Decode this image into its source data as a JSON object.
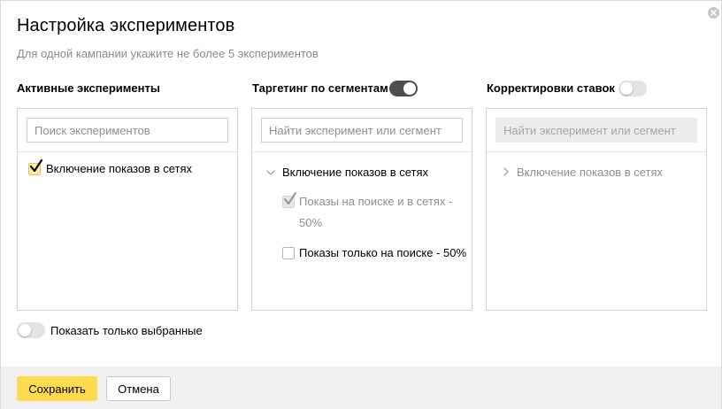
{
  "dialog": {
    "title": "Настройка экспериментов",
    "subtitle": "Для одной кампании укажите не более 5 экспериментов"
  },
  "columns": {
    "active": {
      "header": "Активные эксперименты",
      "search_placeholder": "Поиск экспериментов",
      "items": [
        {
          "label": "Включение показов в сетях",
          "checked": true
        }
      ]
    },
    "targeting": {
      "header": "Таргетинг по сегментам",
      "toggle_on": true,
      "search_placeholder": "Найти эксперимент или сегмент",
      "group": {
        "label": "Включение показов в сетях",
        "expanded": true,
        "segments": [
          {
            "label": "Показы на поиске и в сетях - 50%",
            "checked": true,
            "disabled": true
          },
          {
            "label": "Показы только на поиске - 50%",
            "checked": false,
            "disabled": false
          }
        ]
      }
    },
    "bid_adjustments": {
      "header": "Корректировки ставок",
      "toggle_on": false,
      "search_placeholder": "Найти эксперимент или сегмент",
      "search_disabled": true,
      "group": {
        "label": "Включение показов в сетях",
        "expanded": false
      }
    }
  },
  "show_selected": {
    "label": "Показать только выбранные",
    "toggle_on": false
  },
  "footer": {
    "save_label": "Сохранить",
    "cancel_label": "Отмена"
  },
  "colors": {
    "accent_yellow": "#ffdb4d",
    "checkbox_checked_bg": "#ffeba0",
    "toggle_on": "#4d4d4d",
    "toggle_off": "#e3e3e3",
    "muted_text": "#8f8f8f"
  },
  "icons": {
    "close": "close-icon",
    "checkmark": "checkmark-icon",
    "chevron_down": "chevron-down-icon",
    "chevron_right": "chevron-right-icon"
  }
}
